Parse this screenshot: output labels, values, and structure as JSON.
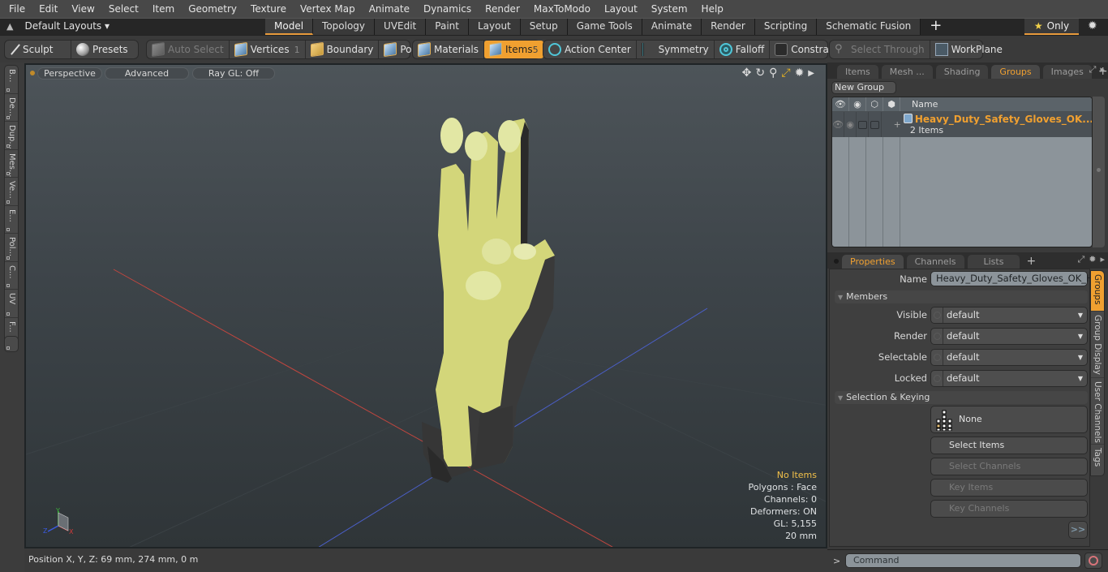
{
  "menubar": {
    "items": [
      "File",
      "Edit",
      "View",
      "Select",
      "Item",
      "Geometry",
      "Texture",
      "Vertex Map",
      "Animate",
      "Dynamics",
      "Render",
      "MaxToModo",
      "Layout",
      "System",
      "Help"
    ]
  },
  "layoutbar": {
    "layouts_label": "Default Layouts ▾",
    "tabs": [
      "Model",
      "Topology",
      "UVEdit",
      "Paint",
      "Layout",
      "Setup",
      "Game Tools",
      "Animate",
      "Render",
      "Scripting",
      "Schematic Fusion"
    ],
    "active_tab": "Model",
    "plus": "+",
    "only_label": "Only"
  },
  "toolbar": {
    "sculpt": "Sculpt",
    "presets": "Presets",
    "auto_select": "Auto Select",
    "vertices": "Vertices",
    "vertices_count": "1",
    "boundary": "Boundary",
    "polygons": "Polygons",
    "materials": "Materials",
    "items": "Items",
    "items_count": "5",
    "action_center": "Action Center",
    "symmetry": "Symmetry",
    "falloff": "Falloff",
    "constraints": "Constrai...",
    "select_through": "Select Through",
    "workplane": "WorkPlane"
  },
  "left_tabs": [
    "B...",
    "De...",
    "Dup...",
    "Mes...",
    "Ve...",
    "E...",
    "Pol...",
    "C...",
    "UV",
    "F..."
  ],
  "viewport": {
    "view_mode": "Perspective",
    "shading": "Advanced",
    "raygl": "Ray GL: Off",
    "hud": {
      "selection": "No Items",
      "polygons": "Polygons : Face",
      "channels": "Channels: 0",
      "deformers": "Deformers: ON",
      "gl": "GL: 5,155",
      "scale": "20 mm"
    },
    "axis_labels": {
      "x": "X",
      "y": "Y",
      "z": "Z"
    }
  },
  "statusbar": {
    "position": "Position X, Y, Z:   69 mm, 274 mm, 0 m"
  },
  "groups_panel": {
    "tabs": [
      "Items",
      "Mesh ...",
      "Shading",
      "Groups",
      "Images"
    ],
    "active_tab": "Groups",
    "new_group": "New Group",
    "column_name": "Name",
    "group": {
      "name": "Heavy_Duty_Safety_Gloves_OK...",
      "subtitle": "2 Items"
    }
  },
  "properties_panel": {
    "tabs": [
      "Properties",
      "Channels",
      "Lists"
    ],
    "active_tab": "Properties",
    "name_label": "Name",
    "name_value": "Heavy_Duty_Safety_Gloves_OK_Han",
    "members_section": "Members",
    "fields": [
      {
        "label": "Visible",
        "value": "default"
      },
      {
        "label": "Render",
        "value": "default"
      },
      {
        "label": "Selectable",
        "value": "default"
      },
      {
        "label": "Locked",
        "value": "default"
      }
    ],
    "selection_section": "Selection & Keying",
    "none_button": "None",
    "select_items": "Select Items",
    "select_channels": "Select Channels",
    "key_items": "Key Items",
    "key_channels": "Key Channels",
    "more": ">>",
    "side_tabs": [
      "Groups",
      "Group Display",
      "User Channels",
      "Tags"
    ],
    "active_side_tab": "Groups"
  },
  "command": {
    "prompt": ">",
    "placeholder": "Command"
  }
}
